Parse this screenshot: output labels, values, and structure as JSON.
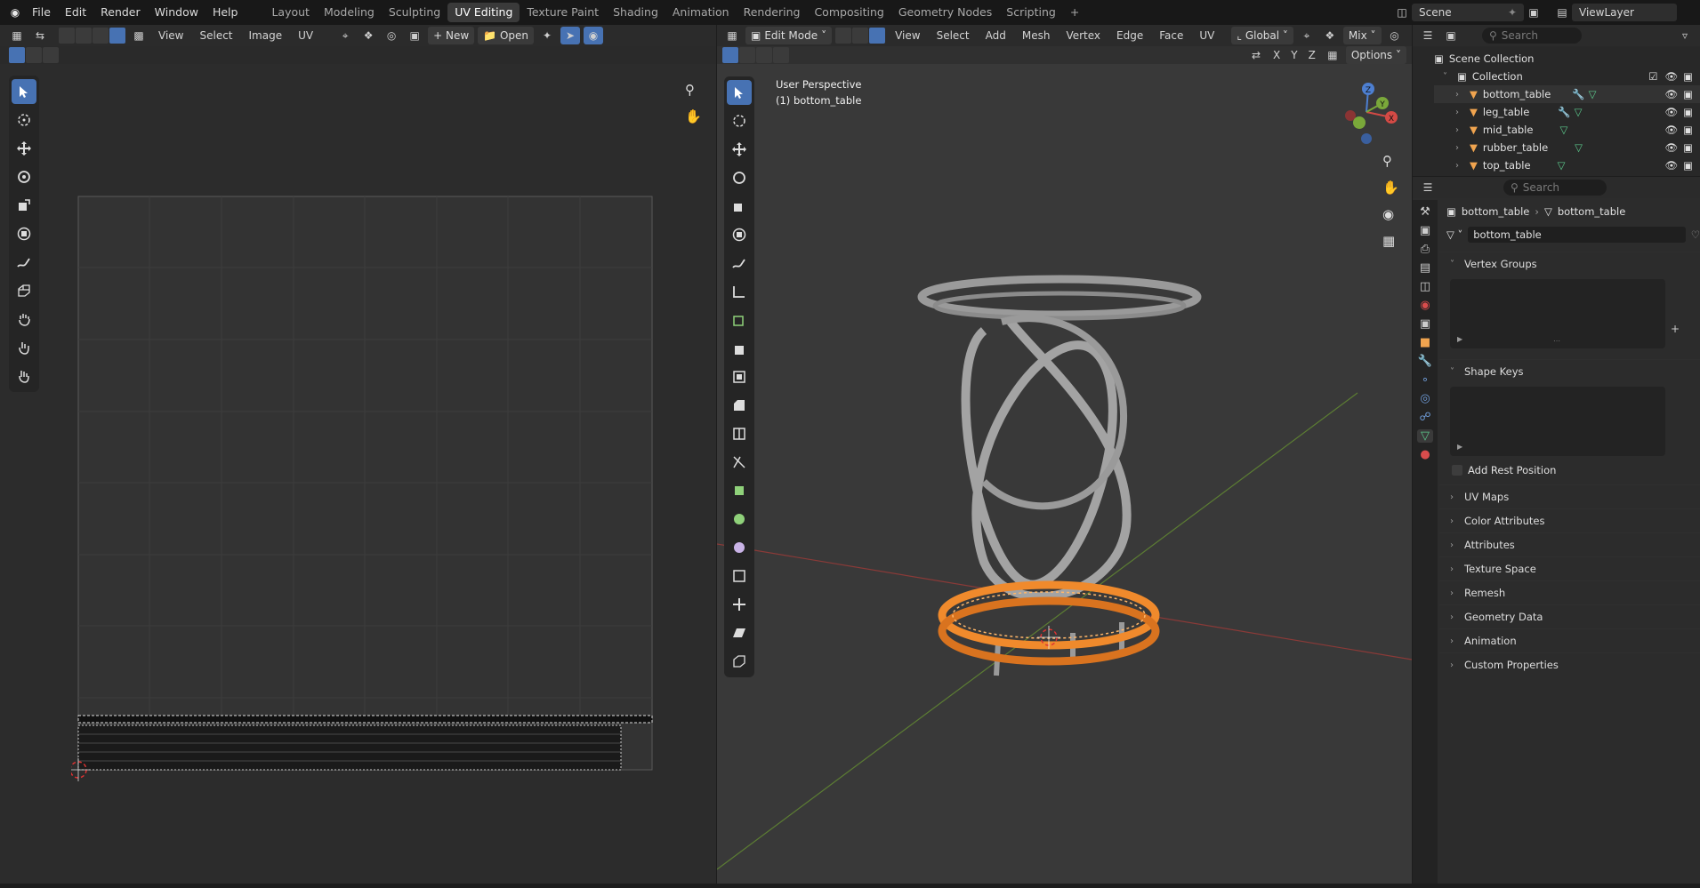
{
  "topbar": {
    "menus": [
      "File",
      "Edit",
      "Render",
      "Window",
      "Help"
    ],
    "workspaces": [
      "Layout",
      "Modeling",
      "Sculpting",
      "UV Editing",
      "Texture Paint",
      "Shading",
      "Animation",
      "Rendering",
      "Compositing",
      "Geometry Nodes",
      "Scripting"
    ],
    "active_workspace": "UV Editing",
    "add_tab": "+",
    "scene": "Scene",
    "view_layer": "ViewLayer"
  },
  "uv_editor": {
    "menus": [
      "View",
      "Select",
      "Image",
      "UV"
    ],
    "new_label": "New",
    "open_label": "Open"
  },
  "viewport": {
    "mode": "Edit Mode",
    "menus": [
      "View",
      "Select",
      "Add",
      "Mesh",
      "Vertex",
      "Edge",
      "Face",
      "UV"
    ],
    "orientation": "Global",
    "snap_label": "Mix",
    "axes": [
      "X",
      "Y",
      "Z"
    ],
    "options_label": "Options",
    "overlay_line1": "User Perspective",
    "overlay_line2": "(1) bottom_table",
    "gizmo": {
      "x": "X",
      "y": "Y",
      "z": "Z"
    },
    "colors": {
      "selected": "#f08a2c",
      "axis_x": "#b8403d",
      "axis_y": "#6e9a3a"
    }
  },
  "outliner": {
    "search_placeholder": "Search",
    "scene_collection": "Scene Collection",
    "collection": "Collection",
    "objects": [
      "bottom_table",
      "leg_table",
      "mid_table",
      "rubber_table",
      "top_table"
    ]
  },
  "properties": {
    "search_placeholder": "Search",
    "breadcrumb_object": "bottom_table",
    "breadcrumb_data": "bottom_table",
    "data_name": "bottom_table",
    "vertex_groups": "Vertex Groups",
    "shape_keys": "Shape Keys",
    "add_rest_position": "Add Rest Position",
    "panels": [
      "UV Maps",
      "Color Attributes",
      "Attributes",
      "Texture Space",
      "Remesh",
      "Geometry Data",
      "Animation",
      "Custom Properties"
    ]
  }
}
